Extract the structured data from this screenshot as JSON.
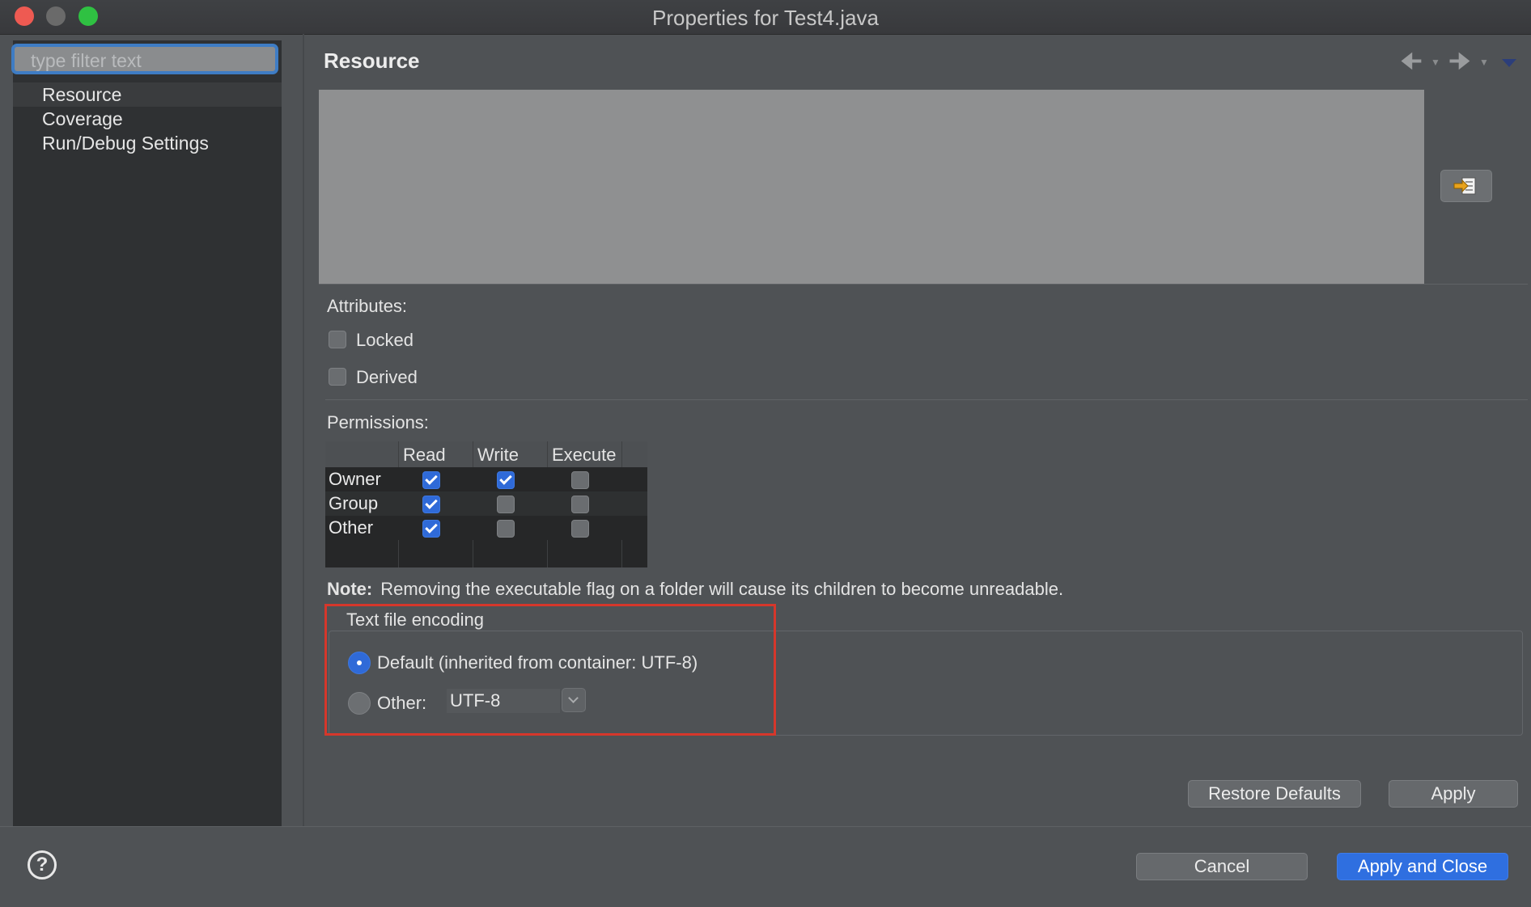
{
  "window": {
    "title": "Properties for Test4.java"
  },
  "sidebar": {
    "filter_placeholder": "type filter text",
    "items": [
      {
        "label": "Resource",
        "selected": true
      },
      {
        "label": "Coverage"
      },
      {
        "label": "Run/Debug Settings"
      }
    ]
  },
  "page": {
    "title": "Resource",
    "nav": {
      "back_icon": "arrow-left-icon",
      "forward_icon": "arrow-right-icon"
    }
  },
  "attributes": {
    "label": "Attributes:",
    "locked": {
      "label": "Locked",
      "checked": false
    },
    "derived": {
      "label": "Derived",
      "checked": false
    }
  },
  "permissions": {
    "label": "Permissions:",
    "columns": [
      "Read",
      "Write",
      "Execute"
    ],
    "rows": [
      {
        "label": "Owner",
        "read": true,
        "write": true,
        "execute": false
      },
      {
        "label": "Group",
        "read": true,
        "write": false,
        "execute": false
      },
      {
        "label": "Other",
        "read": true,
        "write": false,
        "execute": false
      }
    ]
  },
  "note": {
    "label": "Note:",
    "text": "Removing the executable flag on a folder will cause its children to become unreadable."
  },
  "encoding": {
    "group_title": "Text file encoding",
    "default_label": "Default (inherited from container: UTF-8)",
    "default_selected": true,
    "other_label": "Other:",
    "other_value": "UTF-8"
  },
  "buttons": {
    "restore_defaults": "Restore Defaults",
    "apply": "Apply",
    "cancel": "Cancel",
    "apply_and_close": "Apply and Close",
    "help": "?"
  },
  "colors": {
    "accent": "#2f6fe0",
    "highlight_border": "#d6372b",
    "background": "#4f5255",
    "sidebar_bg": "#2f3133"
  }
}
